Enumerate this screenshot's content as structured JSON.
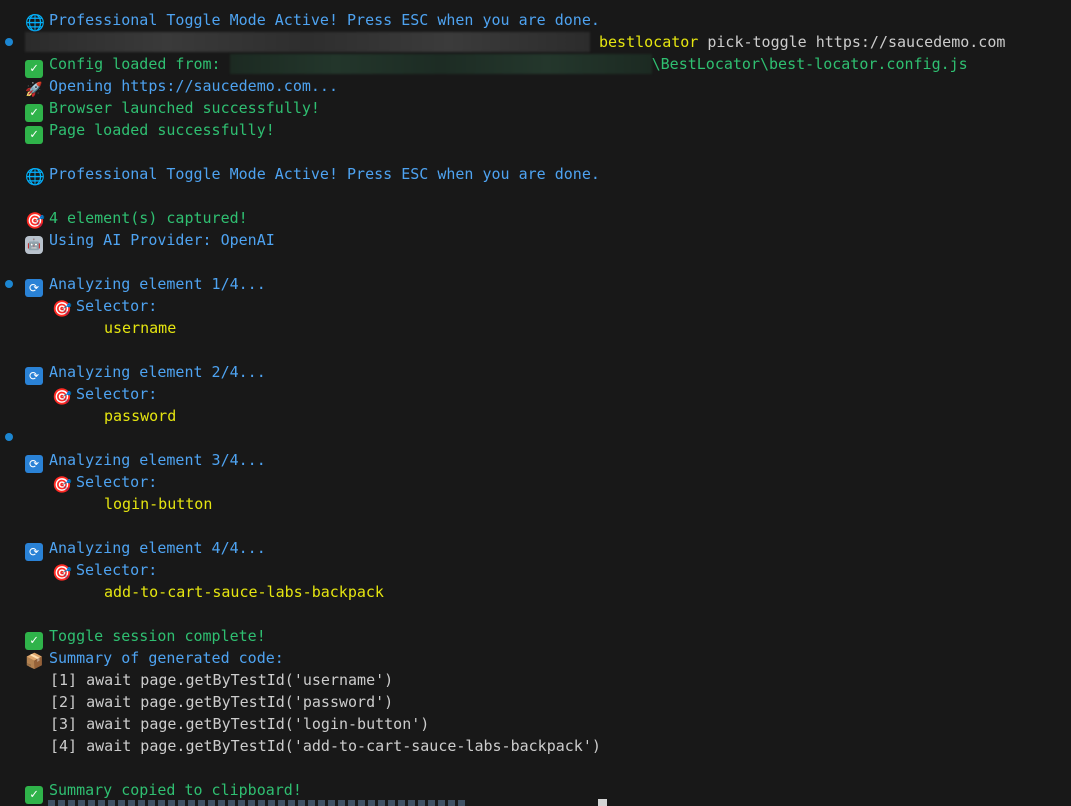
{
  "colors": {
    "background": "#181818",
    "blue": "#4ea3f1",
    "green": "#2fbf71",
    "yellow": "#e5e510",
    "text": "#cccccc"
  },
  "icons": {
    "globe": "globe-icon",
    "check": "check-mark-icon",
    "rocket": "rocket-icon",
    "target": "direct-hit-icon",
    "robot": "robot-icon",
    "cycle": "refresh-icon",
    "box": "package-icon"
  },
  "lines": {
    "mode_active_top": "Professional Toggle Mode Active! Press ESC when you are done.",
    "command_name": "bestlocator",
    "command_args": " pick-toggle https://saucedemo.com",
    "config_loaded_prefix": "Config loaded from: ",
    "config_loaded_suffix": "\\BestLocator\\best-locator.config.js",
    "opening": "Opening https://saucedemo.com...",
    "browser_launched": "Browser launched successfully!",
    "page_loaded": "Page loaded successfully!",
    "mode_active": "Professional Toggle Mode Active! Press ESC when you are done.",
    "captured": "4 element(s) captured!",
    "ai_provider": "Using AI Provider: OpenAI",
    "selector_label": "Selector:",
    "session_complete": "Toggle session complete!",
    "summary_title": "Summary of generated code:",
    "copied": "Summary copied to clipboard!"
  },
  "elements": [
    {
      "analyzing": "Analyzing element 1/4...",
      "selector": "username"
    },
    {
      "analyzing": "Analyzing element 2/4...",
      "selector": "password"
    },
    {
      "analyzing": "Analyzing element 3/4...",
      "selector": "login-button"
    },
    {
      "analyzing": "Analyzing element 4/4...",
      "selector": "add-to-cart-sauce-labs-backpack"
    }
  ],
  "summary": [
    "[1] await page.getByTestId('username')",
    "[2] await page.getByTestId('password')",
    "[3] await page.getByTestId('login-button')",
    "[4] await page.getByTestId('add-to-cart-sauce-labs-backpack')"
  ]
}
